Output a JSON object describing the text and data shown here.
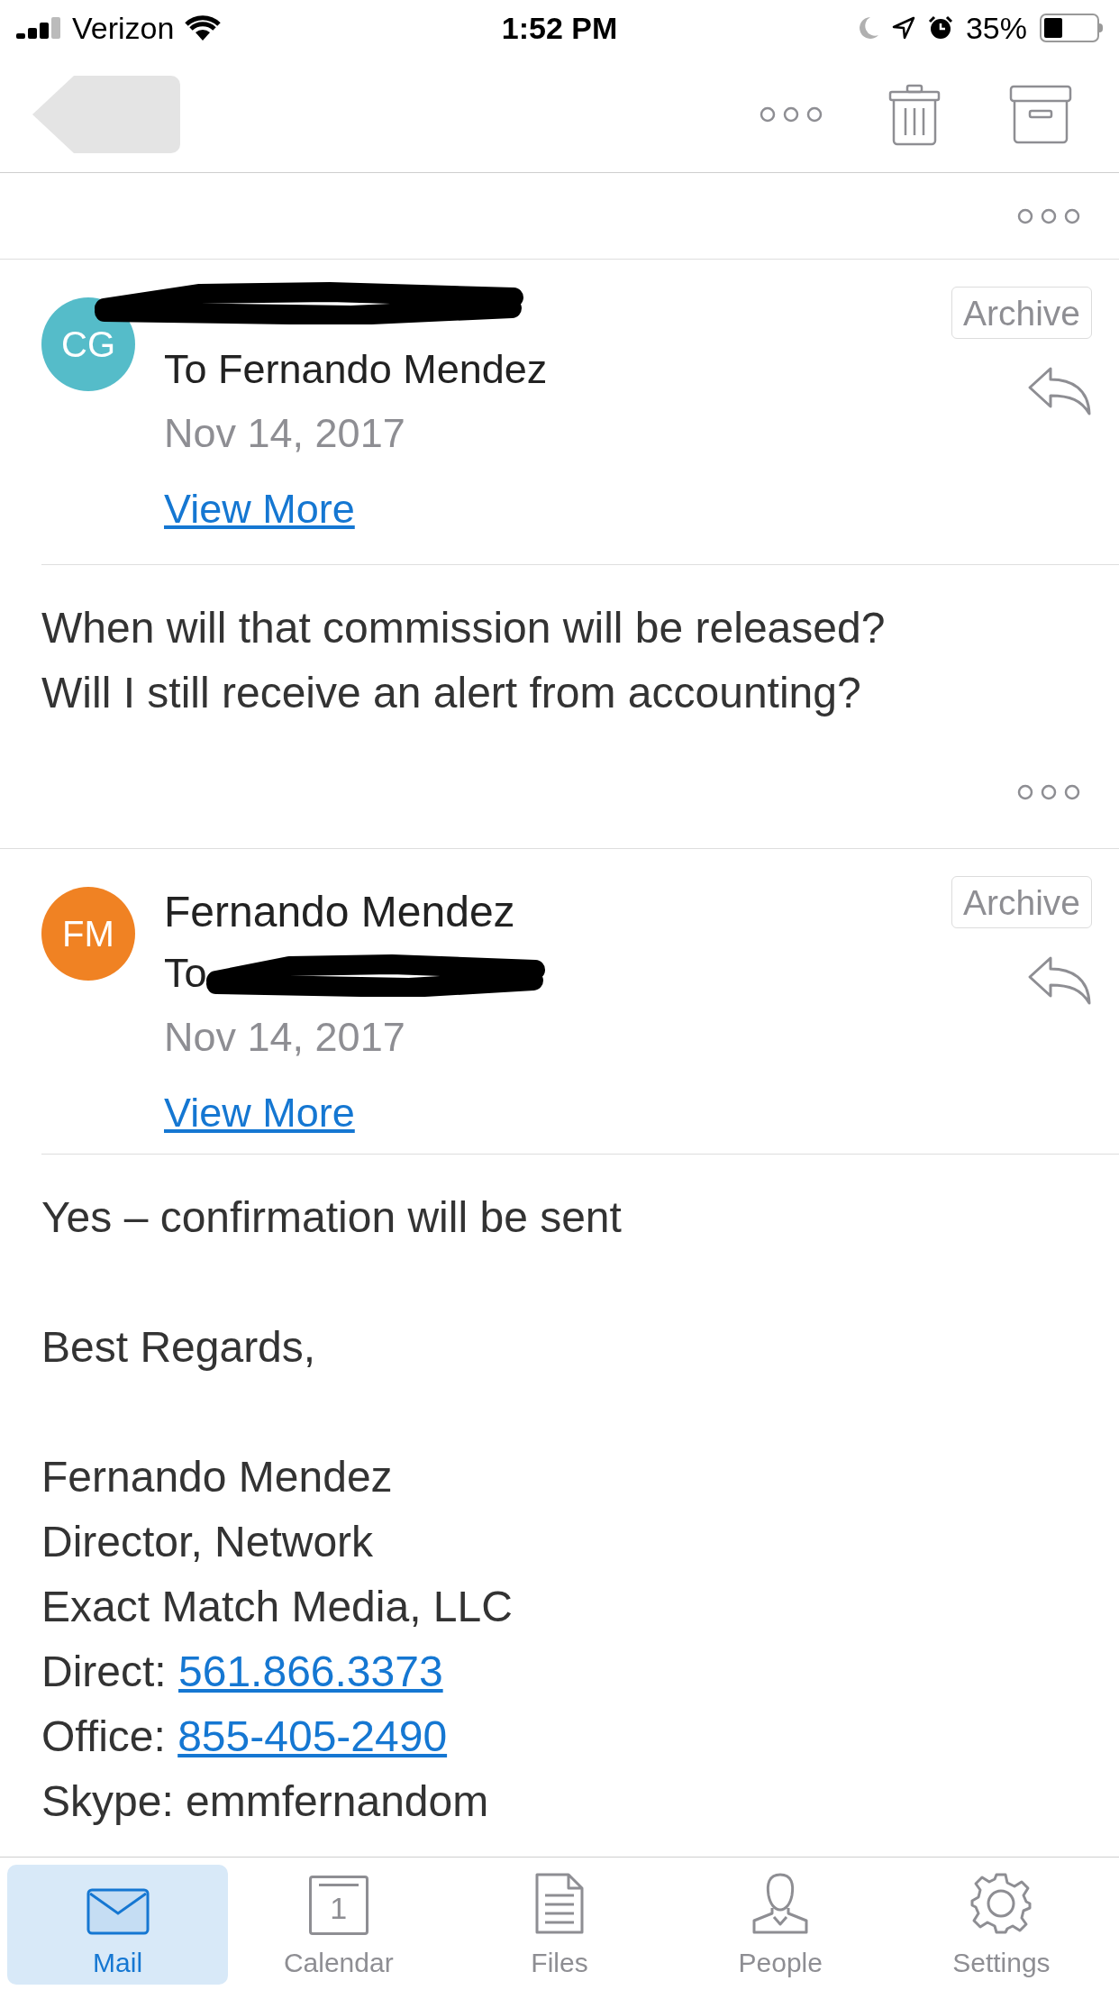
{
  "status_bar": {
    "carrier": "Verizon",
    "time": "1:52 PM",
    "battery": "35%"
  },
  "messages": [
    {
      "initials": "CG",
      "color": "#55bcc9",
      "to": "To Fernando Mendez",
      "to_redacted": false,
      "date": "Nov 14, 2017",
      "view_more": "View More",
      "archive": "Archive",
      "has_more_menu": true,
      "body": [
        {
          "lines": [
            {
              "text": "When will that commission will be released?"
            },
            {
              "text": "Will I still receive an alert from accounting?"
            }
          ]
        }
      ]
    },
    {
      "initials": "FM",
      "color": "#f08223",
      "from": "Fernando Mendez",
      "to": "To",
      "to_redacted": true,
      "date": "Nov 14, 2017",
      "view_more": "View More",
      "archive": "Archive",
      "has_more_menu": false,
      "body": [
        {
          "lines": [
            {
              "text": "Yes – confirmation will be sent"
            }
          ]
        },
        {
          "lines": [
            {
              "text": "Best Regards,"
            }
          ]
        },
        {
          "lines": [
            {
              "text": "Fernando Mendez"
            },
            {
              "text": "Director, Network"
            },
            {
              "text": "Exact Match Media, LLC"
            },
            {
              "text": "Direct: ",
              "link": "561.866.3373"
            },
            {
              "text": "Office: ",
              "link": "855-405-2490"
            },
            {
              "text": "Skype: emmfernandom"
            }
          ]
        }
      ]
    }
  ],
  "tabs": [
    {
      "kind": "mail",
      "label": "Mail",
      "selected": true
    },
    {
      "kind": "calendar",
      "label": "Calendar",
      "selected": false,
      "icon_text": "1"
    },
    {
      "kind": "files",
      "label": "Files",
      "selected": false
    },
    {
      "kind": "people",
      "label": "People",
      "selected": false
    },
    {
      "kind": "settings",
      "label": "Settings",
      "selected": false
    }
  ]
}
